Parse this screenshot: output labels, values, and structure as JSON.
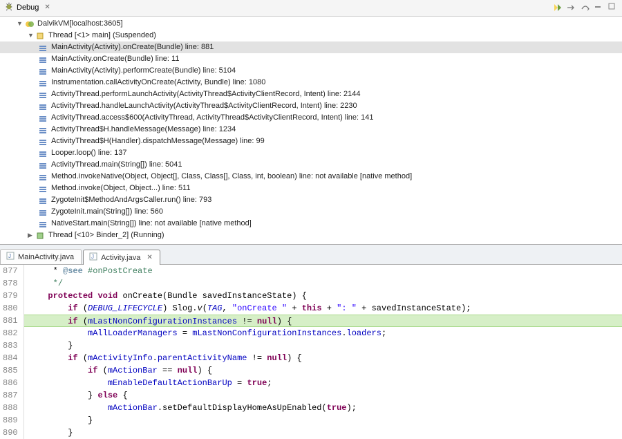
{
  "debug_view": {
    "title": "Debug",
    "process": "DalvikVM[localhost:3605]",
    "thread_main": "Thread [<1> main] (Suspended)",
    "thread_binder": "Thread [<10> Binder_2] (Running)",
    "stack": [
      "MainActivity(Activity).onCreate(Bundle) line: 881",
      "MainActivity.onCreate(Bundle) line: 11",
      "MainActivity(Activity).performCreate(Bundle) line: 5104",
      "Instrumentation.callActivityOnCreate(Activity, Bundle) line: 1080",
      "ActivityThread.performLaunchActivity(ActivityThread$ActivityClientRecord, Intent) line: 2144",
      "ActivityThread.handleLaunchActivity(ActivityThread$ActivityClientRecord, Intent) line: 2230",
      "ActivityThread.access$600(ActivityThread, ActivityThread$ActivityClientRecord, Intent) line: 141",
      "ActivityThread$H.handleMessage(Message) line: 1234",
      "ActivityThread$H(Handler).dispatchMessage(Message) line: 99",
      "Looper.loop() line: 137",
      "ActivityThread.main(String[]) line: 5041",
      "Method.invokeNative(Object, Object[], Class, Class[], Class, int, boolean) line: not available [native method]",
      "Method.invoke(Object, Object...) line: 511",
      "ZygoteInit$MethodAndArgsCaller.run() line: 793",
      "ZygoteInit.main(String[]) line: 560",
      "NativeStart.main(String[]) line: not available [native method]"
    ]
  },
  "editor": {
    "tabs": {
      "inactive": "MainActivity.java",
      "active": "Activity.java"
    },
    "first_line": 877,
    "lines": [
      {
        "n": 877,
        "html": "     * <span class=\"tag\">@see</span> <span class=\"cmt\">#onPostCreate</span>"
      },
      {
        "n": 878,
        "html": "     <span class=\"cmt\">*/</span>"
      },
      {
        "n": 879,
        "html": "    <span class=\"kw\">protected</span> <span class=\"kw\">void</span> onCreate(Bundle savedInstanceState) {"
      },
      {
        "n": 880,
        "html": "        <span class=\"kw\">if</span> (<span class=\"fld mth\">DEBUG_LIFECYCLE</span>) Slog.<span class=\"mth\">v</span>(<span class=\"fld mth\">TAG</span>, <span class=\"str\">\"onCreate \"</span> + <span class=\"kw\">this</span> + <span class=\"str\">\": \"</span> + savedInstanceState);"
      },
      {
        "n": 881,
        "html": "        <span class=\"kw\">if</span> (<span class=\"fld\">mLastNonConfigurationInstances</span> != <span class=\"kw\">null</span>) {",
        "current": true
      },
      {
        "n": 882,
        "html": "            <span class=\"fld\">mAllLoaderManagers</span> = <span class=\"fld\">mLastNonConfigurationInstances</span>.<span class=\"fld\">loaders</span>;"
      },
      {
        "n": 883,
        "html": "        }"
      },
      {
        "n": 884,
        "html": "        <span class=\"kw\">if</span> (<span class=\"fld\">mActivityInfo</span>.<span class=\"fld\">parentActivityName</span> != <span class=\"kw\">null</span>) {"
      },
      {
        "n": 885,
        "html": "            <span class=\"kw\">if</span> (<span class=\"fld\">mActionBar</span> == <span class=\"kw\">null</span>) {"
      },
      {
        "n": 886,
        "html": "                <span class=\"fld\">mEnableDefaultActionBarUp</span> = <span class=\"kw\">true</span>;"
      },
      {
        "n": 887,
        "html": "            } <span class=\"kw\">else</span> {"
      },
      {
        "n": 888,
        "html": "                <span class=\"fld\">mActionBar</span>.setDefaultDisplayHomeAsUpEnabled(<span class=\"kw\">true</span>);"
      },
      {
        "n": 889,
        "html": "            }"
      },
      {
        "n": 890,
        "html": "        }"
      }
    ]
  }
}
